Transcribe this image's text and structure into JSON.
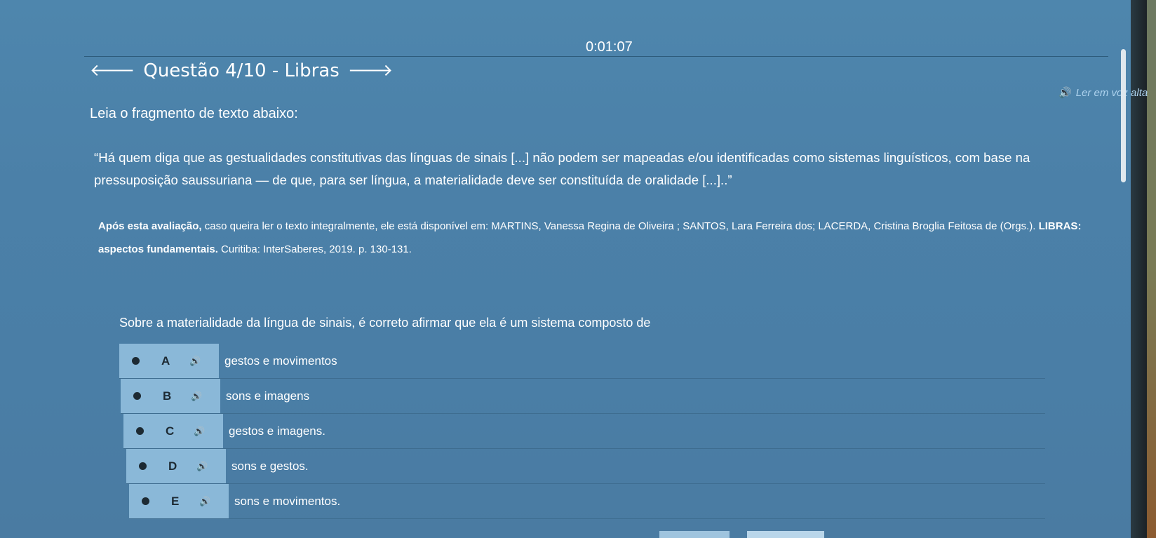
{
  "timer": "0:01:07",
  "header": {
    "prev_icon": "arrow-left-icon",
    "title": "Questão 4/10 - Libras",
    "next_icon": "arrow-right-icon"
  },
  "read_aloud": {
    "icon": "speaker-icon",
    "label": "Ler em voz alta"
  },
  "instruction": "Leia o fragmento de texto abaixo:",
  "quote": "“Há quem diga que as gestualidades constitutivas das línguas de sinais [...] não podem ser mapeadas e/ou identificadas como sistemas linguísticos, com base na pressuposição saussuriana — de que, para ser língua, a materialidade deve ser constituída de oralidade [...]..”",
  "citation": {
    "lead": "Após esta avaliação,",
    "body": " caso queira ler o texto integralmente, ele está disponível em: MARTINS, Vanessa Regina de Oliveira ; SANTOS, Lara Ferreira dos; LACERDA, Cristina Broglia Feitosa de (Orgs.).",
    "title": " LIBRAS: aspectos fundamentais.",
    "tail": " Curitiba: InterSaberes, 2019. p. 130-131."
  },
  "prompt": "Sobre a materialidade da língua de sinais, é correto afirmar que ela é um sistema composto de",
  "options": [
    {
      "letter": "A",
      "text": "gestos e movimentos"
    },
    {
      "letter": "B",
      "text": "sons e imagens"
    },
    {
      "letter": "C",
      "text": "gestos e imagens."
    },
    {
      "letter": "D",
      "text": "sons e gestos."
    },
    {
      "letter": "E",
      "text": "sons e movimentos."
    }
  ]
}
